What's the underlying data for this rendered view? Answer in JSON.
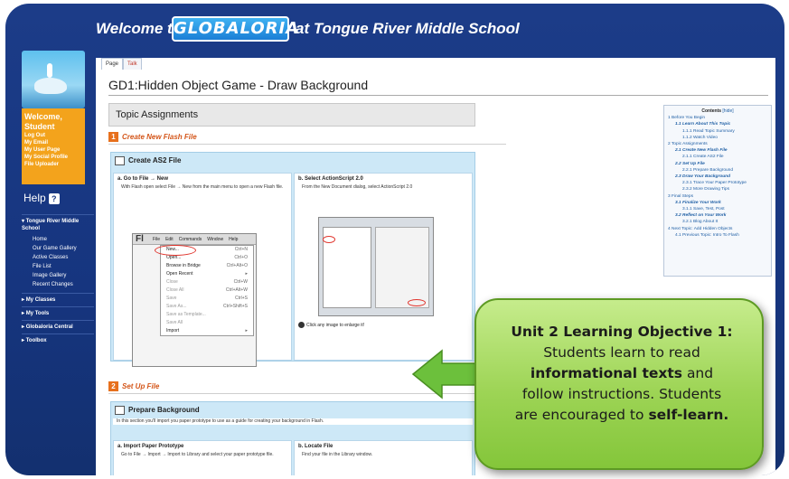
{
  "banner": {
    "welcome": "Welcome to",
    "logo": "GLOBALORIA",
    "school": "at Tongue River Middle School"
  },
  "sidebar": {
    "greeting_line1": "Welcome,",
    "greeting_line2": "Student",
    "links": [
      "Log Out",
      "My Email",
      "My User Page",
      "My Social Profile",
      "File Uploader"
    ],
    "help_label": "Help",
    "sections": [
      {
        "label": "Tongue River Middle School",
        "items": [
          "Home",
          "Our Game Gallery",
          "Active Classes",
          "File List",
          "Image Gallery",
          "Recent Changes"
        ]
      },
      {
        "label": "My Classes",
        "items": []
      },
      {
        "label": "My Tools",
        "items": []
      },
      {
        "label": "Globaloria Central",
        "items": []
      },
      {
        "label": "Toolbox",
        "items": []
      }
    ]
  },
  "tabs": {
    "page": "Page",
    "talk": "Talk"
  },
  "page_title": "GD1:Hidden Object Game - Draw Background",
  "topic_bar": "Topic Assignments",
  "step1": {
    "num": "1",
    "title": "Create New Flash File",
    "box_title": "Create AS2 File",
    "col_a_head": "a. Go to File → New",
    "col_a_text": "With Flash open select File → New from the main menu to open a new Flash file.",
    "col_b_head": "b. Select ActionScript 2.0",
    "col_b_text": "From the New Document dialog, select ActionScript 2.0",
    "enlarge": "Click any image to enlarge it!",
    "menu": {
      "logo": "Fl",
      "bar": [
        "File",
        "Edit",
        "Commands",
        "Window",
        "Help"
      ],
      "items": [
        {
          "label": "New...",
          "sc": "Ctrl+N"
        },
        {
          "label": "Open...",
          "sc": "Ctrl+O"
        },
        {
          "label": "Browse in Bridge",
          "sc": "Ctrl+Alt+O"
        },
        {
          "label": "Open Recent",
          "sc": "▸"
        },
        {
          "label": "Close",
          "sc": "Ctrl+W"
        },
        {
          "label": "Close All",
          "sc": "Ctrl+Alt+W"
        },
        {
          "label": "Save",
          "sc": "Ctrl+S"
        },
        {
          "label": "Save As...",
          "sc": "Ctrl+Shift+S"
        },
        {
          "label": "Save as Template...",
          "sc": ""
        },
        {
          "label": "Save All",
          "sc": ""
        },
        {
          "label": "Import",
          "sc": "▸"
        }
      ]
    }
  },
  "step2": {
    "num": "2",
    "title": "Set Up File",
    "box_title": "Prepare Background",
    "intro": "In this section you'll import you paper prototype to use as a guide for creating your background in Flash.",
    "col_a_head": "a. Import Paper Prototype",
    "col_a_text": "Go to File → Import → Import to Library and select your paper prototype file.",
    "col_b_head": "b. Locate File",
    "col_b_text": "Find your file in the Library window."
  },
  "toc": {
    "title": "Contents",
    "hide": "[hide]",
    "entries": [
      {
        "level": 1,
        "text": "1 Before You Begin",
        "em": false
      },
      {
        "level": 2,
        "text": "1.1 Learn About This Topic",
        "em": true
      },
      {
        "level": 3,
        "text": "1.1.1 Read Topic Summary",
        "em": false
      },
      {
        "level": 3,
        "text": "1.1.2 Watch Video",
        "em": false
      },
      {
        "level": 1,
        "text": "2 Topic Assignments",
        "em": false
      },
      {
        "level": 2,
        "text": "2.1 Create New Flash File",
        "em": true
      },
      {
        "level": 3,
        "text": "2.1.1 Create AS2 File",
        "em": false
      },
      {
        "level": 2,
        "text": "2.2 Set Up File",
        "em": true
      },
      {
        "level": 3,
        "text": "2.2.1 Prepare Background",
        "em": false
      },
      {
        "level": 2,
        "text": "2.3 Draw Your Background",
        "em": true
      },
      {
        "level": 3,
        "text": "2.3.1 Trace Your Paper Prototype",
        "em": false
      },
      {
        "level": 3,
        "text": "2.3.2 More Drawing Tips",
        "em": false
      },
      {
        "level": 1,
        "text": "3 Final Steps",
        "em": false
      },
      {
        "level": 2,
        "text": "3.1 Finalize Your Work",
        "em": true
      },
      {
        "level": 3,
        "text": "3.1.1 Save, Test, Post",
        "em": false
      },
      {
        "level": 2,
        "text": "3.2 Reflect on Your Work",
        "em": true
      },
      {
        "level": 3,
        "text": "3.2.1 Blog About It",
        "em": false
      },
      {
        "level": 1,
        "text": "4 Next Topic: Add Hidden Objects",
        "em": false
      },
      {
        "level": 2,
        "text": "4.1 Previous Topic: Intro To Flash",
        "em": false
      }
    ]
  },
  "callout": {
    "title": "Unit 2 Learning Objective 1:",
    "t1": "Students learn to read",
    "t2": "informational texts",
    "t3": "and",
    "t4": "follow instructions. Students",
    "t5": "are encouraged to",
    "t6": "self-learn.",
    "colors": {
      "fill": "#9dd455",
      "border": "#5d9a23",
      "arrow": "#6cc03c"
    }
  }
}
